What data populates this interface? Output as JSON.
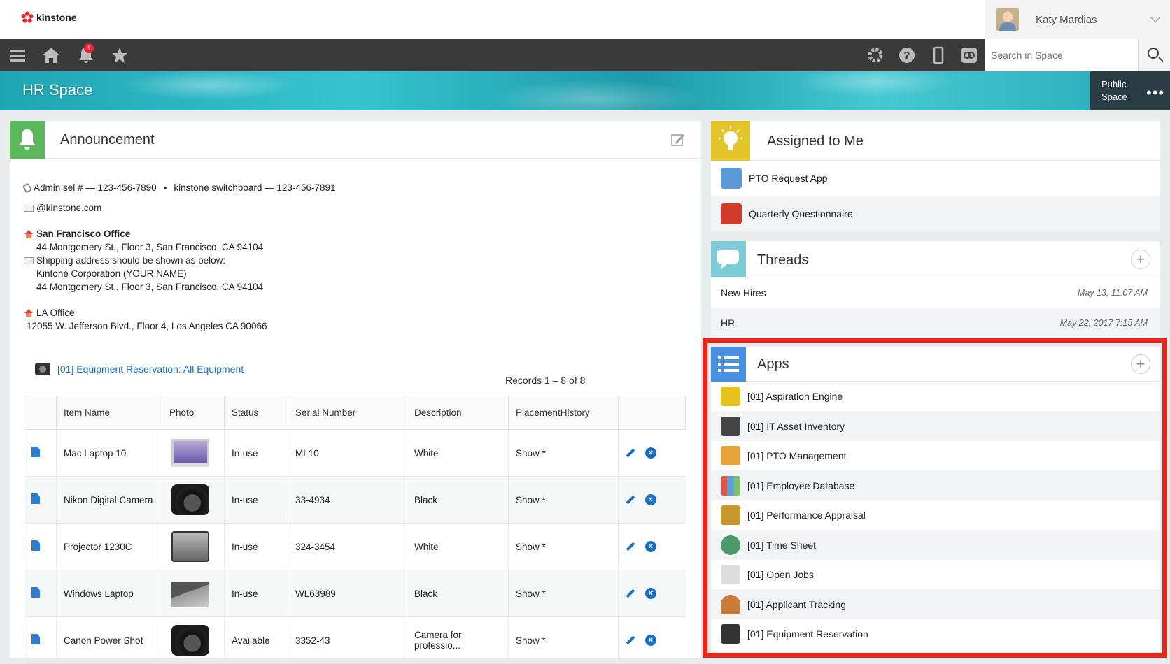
{
  "brand": {
    "name": "kinstone"
  },
  "user": {
    "name": "Katy Mardias"
  },
  "nav": {
    "notification_count": "1",
    "search_placeholder": "Search in Space"
  },
  "space": {
    "title": "HR Space",
    "visibility": "Public Space",
    "more": "•••"
  },
  "announcement": {
    "title": "Announcement",
    "phone_line": "Admin sel # — 123-456-7890",
    "switchboard": "kinstone switchboard — 123-456-7891",
    "email": "@kinstone.com",
    "sf_office": "San Francisco Office",
    "sf_address": "44 Montgomery St., Floor 3, San Francisco, CA 94104",
    "shipping_note": "Shipping address should be shown as below:",
    "shipping_name": "Kintone Corporation (YOUR NAME)",
    "shipping_address": "44 Montgomery St., Floor 3, San Francisco, CA 94104",
    "la_office": "LA Office",
    "la_address": "12055 W. Jefferson Blvd., Floor 4, Los Angeles CA 90066",
    "list_link": "[01]  Equipment Reservation: All Equipment",
    "records": "Records 1 – 8 of 8",
    "columns": [
      "Item Name",
      "Photo",
      "Status",
      "Serial Number",
      "Description",
      "PlacementHistory"
    ],
    "rows": [
      {
        "item": "Mac Laptop 10",
        "status": "In-use",
        "serial": "ML10",
        "desc": "White",
        "history": "Show *",
        "photo": "laptop"
      },
      {
        "item": "Nikon Digital Camera",
        "status": "In-use",
        "serial": "33-4934",
        "desc": "Black",
        "history": "Show *",
        "photo": "camera"
      },
      {
        "item": "Projector 1230C",
        "status": "In-use",
        "serial": "324-3454",
        "desc": "White",
        "history": "Show *",
        "photo": "projector"
      },
      {
        "item": "Windows Laptop",
        "status": "In-use",
        "serial": "WL63989",
        "desc": "Black",
        "history": "Show *",
        "photo": "laptop"
      },
      {
        "item": "Canon Power Shot",
        "status": "Available",
        "serial": "3352-43",
        "desc": "Camera for professio...",
        "history": "Show *",
        "photo": "camera"
      }
    ]
  },
  "assigned": {
    "title": "Assigned to Me",
    "items": [
      {
        "label": "PTO Request App",
        "icon": "list-icon",
        "color": "#5b9bd5"
      },
      {
        "label": "Quarterly Questionnaire",
        "icon": "survey-icon",
        "color": "#d23a2c"
      }
    ]
  },
  "threads": {
    "title": "Threads",
    "items": [
      {
        "label": "New Hires",
        "time": "May 13, 11:07 AM"
      },
      {
        "label": "HR",
        "time": "May 22, 2017 7:15 AM"
      }
    ]
  },
  "apps": {
    "title": "Apps",
    "items": [
      {
        "label": "[01]  Aspiration Engine",
        "icon": "lightbulb-icon",
        "color": "#e8c21c"
      },
      {
        "label": "[01]  IT Asset Inventory",
        "icon": "camera-icon",
        "color": "#444444"
      },
      {
        "label": "[01]  PTO Management",
        "icon": "calendar-icon",
        "color": "#e8a23c"
      },
      {
        "label": "[01]  Employee Database",
        "icon": "folders-icon",
        "color": "#d9564a"
      },
      {
        "label": "[01]  Performance Appraisal",
        "icon": "trophy-icon",
        "color": "#c9982a"
      },
      {
        "label": "[01]  Time Sheet",
        "icon": "clock-icon",
        "color": "#4a9a6a"
      },
      {
        "label": "[01]  Open Jobs",
        "icon": "document-icon",
        "color": "#dddddd"
      },
      {
        "label": "[01]  Applicant Tracking",
        "icon": "person-icon",
        "color": "#c77a3a"
      },
      {
        "label": "[01]  Equipment Reservation",
        "icon": "camera-icon",
        "color": "#333333"
      }
    ]
  },
  "colors": {
    "accent": "#1a6fc4",
    "highlight": "#e8261b",
    "announcement": "#5cb85c",
    "assigned": "#e3c52a",
    "threads": "#7ccbd6",
    "apps": "#4a90e2"
  }
}
